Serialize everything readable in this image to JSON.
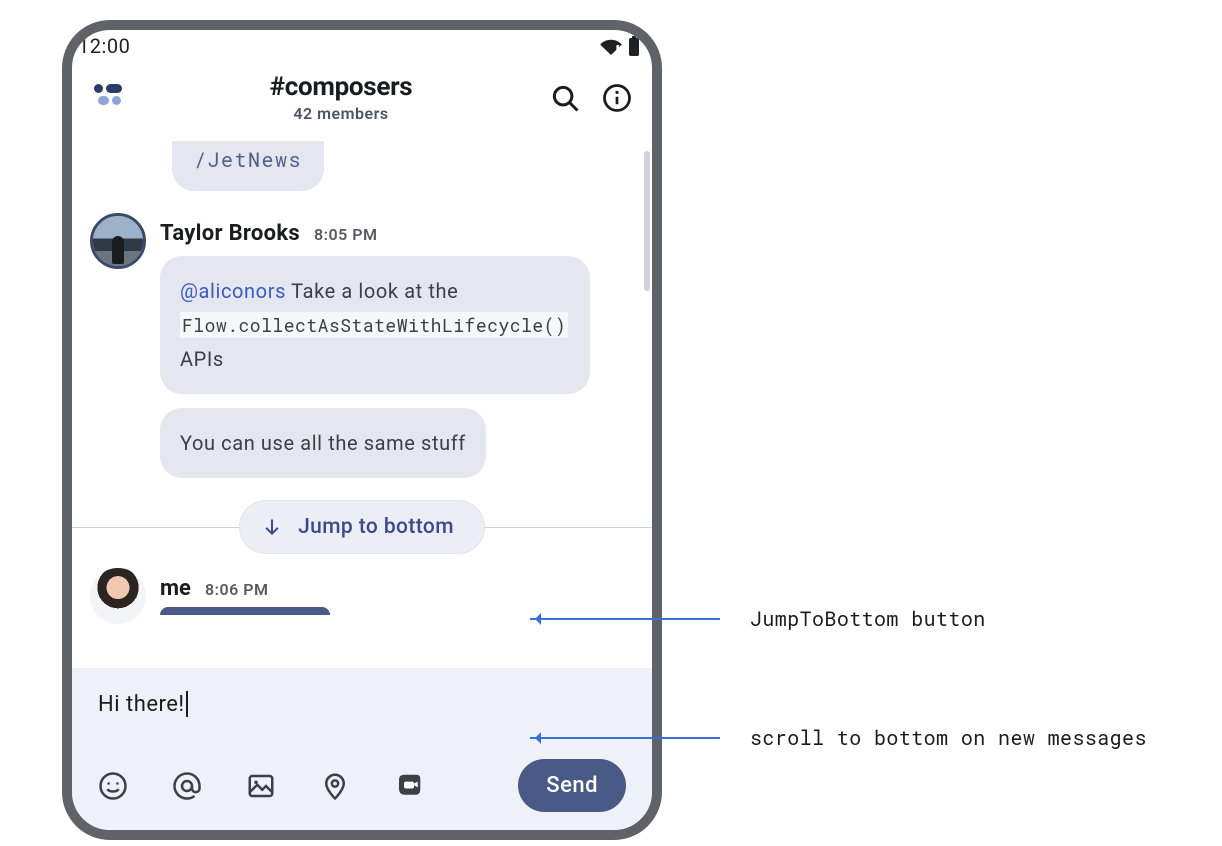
{
  "statusbar": {
    "time": "12:00"
  },
  "header": {
    "channel": "#composers",
    "subtitle": "42 members"
  },
  "truncated_message": "/JetNews",
  "thread": {
    "author": "Taylor Brooks",
    "time": "8:05 PM",
    "msg1_mention": "@aliconors",
    "msg1_pre": " Take a look at the ",
    "msg1_code": "Flow.collectAsStateWithLifecycle()",
    "msg1_post": " APIs",
    "msg2": "You can use all the same stuff"
  },
  "jump_label": "Jump to bottom",
  "me": {
    "author": "me",
    "time": "8:06 PM"
  },
  "composer": {
    "draft": "Hi there!",
    "send_label": "Send"
  },
  "annotations": {
    "a1": "JumpToBottom button",
    "a2": "scroll to bottom on new messages"
  }
}
